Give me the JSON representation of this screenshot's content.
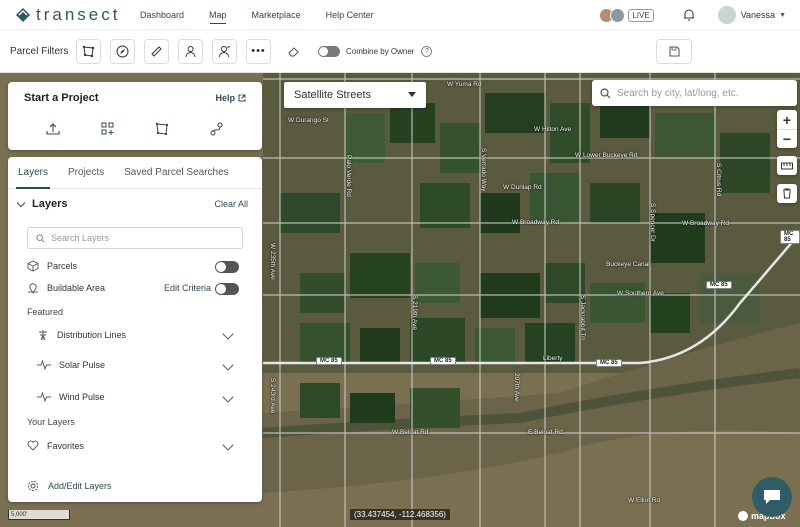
{
  "nav": {
    "brand": "transect",
    "links": [
      "Dashboard",
      "Map",
      "Marketplace",
      "Help Center"
    ],
    "active_link": "Map",
    "live_badge": "LIVE",
    "user_name": "Vanessa"
  },
  "toolbar": {
    "title": "Parcel Filters",
    "combine_label": "Combine by Owner"
  },
  "map": {
    "style_select": "Satellite Streets",
    "search_placeholder": "Search by city, lat/long, etc.",
    "coords": "(33.437454, -112.468356)",
    "scale": "5,000'",
    "attribution": "mapbox",
    "labels": {
      "yuma": "W Yuma Rd",
      "durango": "W Durango St",
      "hilton": "W Hilton Ave",
      "buckeye": "W Lower Buckeye Rd",
      "dunlap": "W Dunlap Rd",
      "broadway": "W Broadway Rd",
      "broadway2": "W Broadway Rd",
      "southern": "W Southern Ave",
      "baseline": "Buckeye Canal",
      "beloat": "W Beloat Rd",
      "beloat2": "E Beloat Rd",
      "elliot": "W Elliot Rd",
      "mc85_a": "MC 85",
      "mc85_b": "MC 85",
      "mc85_c": "MC 85",
      "mc85_d": "MC 85",
      "mc85_e": "MC 85",
      "liberty": "Liberty",
      "av243": "S 243rd Ave",
      "av235": "W 235th Ave",
      "av219": "S 219th Ave",
      "av211": "S 211th Ave",
      "av203": "207th Ave",
      "airfield": "S Airfield Rd",
      "verrado": "S Verrado Way",
      "jackrabbit": "S Jackrabbit Trl",
      "spencer": "S Spencer Dr",
      "citrus": "S Citrus Rd",
      "sorry": "Palo Verde Rd"
    }
  },
  "project_card": {
    "title": "Start a Project",
    "help": "Help"
  },
  "layers_panel": {
    "tabs": [
      "Layers",
      "Projects",
      "Saved Parcel Searches"
    ],
    "heading": "Layers",
    "clear_all": "Clear All",
    "search_placeholder": "Search Layers",
    "parcels": "Parcels",
    "buildable": "Buildable Area",
    "edit_criteria": "Edit Criteria",
    "featured": "Featured",
    "distribution": "Distribution Lines",
    "solar": "Solar Pulse",
    "wind": "Wind Pulse",
    "your_layers": "Your Layers",
    "favorites": "Favorites",
    "add_edit": "Add/Edit Layers"
  },
  "colors": {
    "brand": "#2f4a50",
    "chat": "#2e5d67"
  }
}
